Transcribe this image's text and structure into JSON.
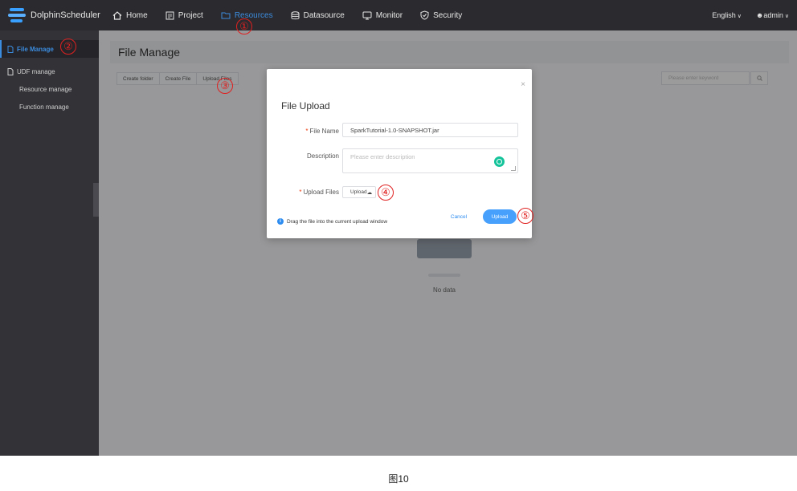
{
  "app": {
    "name": "DolphinScheduler"
  },
  "nav": [
    {
      "label": "Home",
      "icon": "home-icon"
    },
    {
      "label": "Project",
      "icon": "project-icon"
    },
    {
      "label": "Resources",
      "icon": "folder-icon"
    },
    {
      "label": "Datasource",
      "icon": "database-icon"
    },
    {
      "label": "Monitor",
      "icon": "monitor-icon"
    },
    {
      "label": "Security",
      "icon": "shield-icon"
    }
  ],
  "top_right": {
    "language": "English",
    "user": "admin"
  },
  "sidebar": {
    "items": [
      {
        "label": "File Manage",
        "icon": "file-icon"
      },
      {
        "label": "UDF manage",
        "icon": "file-icon"
      }
    ],
    "sub_items": [
      "Resource manage",
      "Function manage"
    ]
  },
  "page": {
    "title": "File Manage",
    "toolbar": [
      "Create folder",
      "Create File",
      "Upload Files"
    ],
    "search_placeholder": "Please enter keyword",
    "empty_text": "No data"
  },
  "modal": {
    "title": "File Upload",
    "close_glyph": "×",
    "file_name_label": "File Name",
    "file_name_value": "SparkTutorial-1.0-SNAPSHOT.jar",
    "description_label": "Description",
    "description_placeholder": "Please enter description",
    "upload_files_label": "Upload Files",
    "upload_button": "Upload",
    "tip": "Drag the file into the current upload window",
    "cancel": "Cancel",
    "submit": "Upload"
  },
  "markers": [
    "①",
    "②",
    "③",
    "④",
    "⑤"
  ],
  "caption": "图10",
  "colors": {
    "topbar": "#2b2b2f",
    "sidebar": "#323237",
    "accent": "#3b8bde",
    "primary": "#46a0fc",
    "marker": "#e02020"
  }
}
